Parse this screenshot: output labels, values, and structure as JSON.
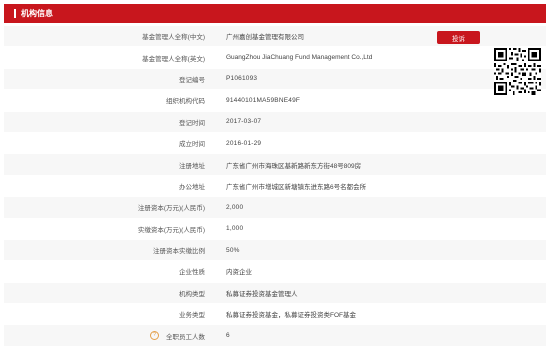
{
  "header": {
    "title": "机构信息"
  },
  "complain_button": "投诉",
  "rows": [
    {
      "label": "基金管理人全称(中文)",
      "value": "广州嘉创基金管理有限公司"
    },
    {
      "label": "基金管理人全称(英文)",
      "value": "GuangZhou JiaChuang Fund Management Co.,Ltd"
    },
    {
      "label": "登记编号",
      "value": "P1061093"
    },
    {
      "label": "组织机构代码",
      "value": "91440101MA59BNE49F"
    },
    {
      "label": "登记时间",
      "value": "2017-03-07"
    },
    {
      "label": "成立时间",
      "value": "2016-01-29"
    },
    {
      "label": "注册地址",
      "value": "广东省广州市海珠区基新路新东方街48号809房"
    },
    {
      "label": "办公地址",
      "value": "广东省广州市增城区新塘镇东进东路6号名都会所"
    },
    {
      "label": "注册资本(万元)(人民币)",
      "value": "2,000"
    },
    {
      "label": "实缴资本(万元)(人民币)",
      "value": "1,000"
    },
    {
      "label": "注册资本实缴比例",
      "value": "50%"
    },
    {
      "label": "企业性质",
      "value": "内资企业"
    },
    {
      "label": "机构类型",
      "value": "私募证券投资基金管理人"
    },
    {
      "label": "业务类型",
      "value": "私募证券投资基金，私募证券投资类FOF基金"
    },
    {
      "label": "全职员工人数",
      "value": "6",
      "help_icon": "?"
    }
  ]
}
